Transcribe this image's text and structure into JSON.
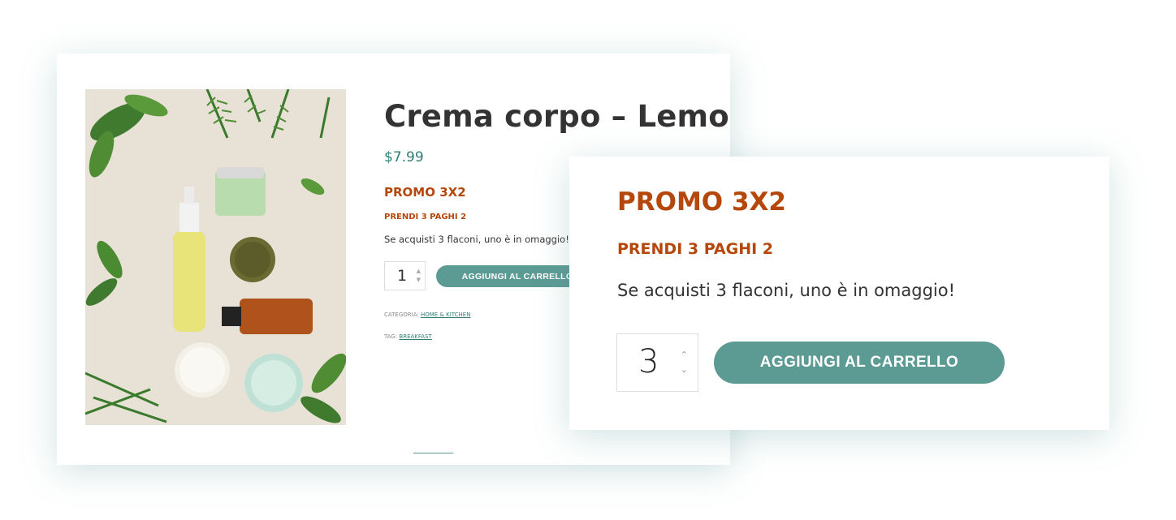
{
  "product": {
    "title": "Crema corpo – Lemon",
    "price": "$7.99",
    "promo_title": "PROMO 3X2",
    "promo_subtitle": "PRENDI 3 PAGHI 2",
    "description": "Se acquisti 3 flaconi, uno è in omaggio!",
    "quantity": "1",
    "add_to_cart_label": "AGGIUNGI AL CARRELLO",
    "category_label": "CATEGORIA:",
    "category_value": "HOME & KITCHEN",
    "tag_label": "TAG:",
    "tag_value": "BREAKFAST"
  },
  "zoom": {
    "promo_title": "PROMO 3X2",
    "promo_subtitle": "PRENDI 3 PAGHI 2",
    "description": "Se acquisti 3 flaconi, uno è in omaggio!",
    "quantity": "3",
    "add_to_cart_label": "AGGIUNGI AL CARRELLO"
  },
  "icons": {
    "qty_up": "chevron-up-icon",
    "qty_down": "chevron-down-icon"
  },
  "colors": {
    "accent": "#5c9a94",
    "price": "#2f7d76",
    "promo": "#b5470b",
    "text": "#333333"
  }
}
